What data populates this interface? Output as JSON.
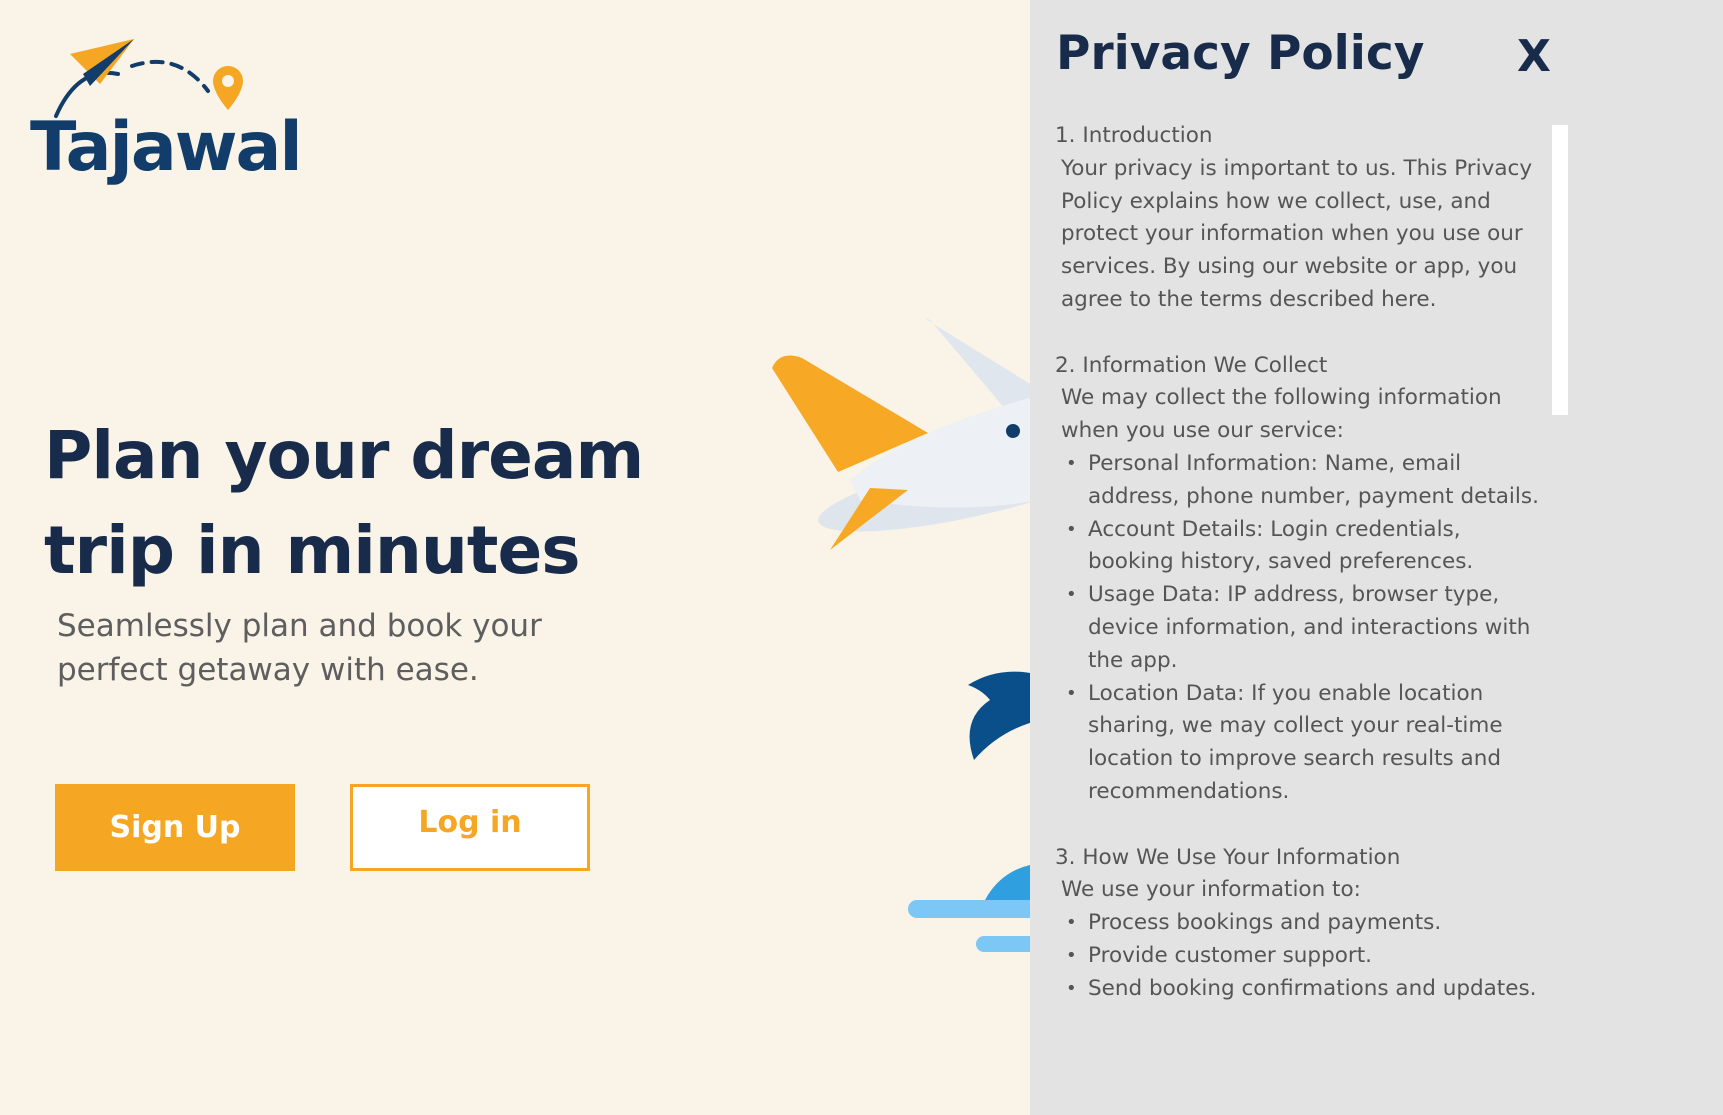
{
  "brand": {
    "name": "Tajawal"
  },
  "hero": {
    "title_line1": "Plan your dream",
    "title_line2": "trip in minutes",
    "subtitle_line1": "Seamlessly plan and book your",
    "subtitle_line2": "perfect getaway with ease."
  },
  "actions": {
    "signup_label": "Sign Up",
    "login_label": "Log in"
  },
  "colors": {
    "accent": "#f5a623",
    "navy": "#182b4a",
    "background": "#f9f3e8",
    "panel": "#e3e3e3"
  },
  "privacy_panel": {
    "title": "Privacy Policy",
    "close_label": "X",
    "sections": [
      {
        "heading": "1. Introduction",
        "body": "Your privacy is important to us. This Privacy Policy explains how we collect, use, and protect your information when you use our services. By using our website or app, you agree to the terms described here.",
        "items": []
      },
      {
        "heading": "2. Information We Collect",
        "body": "We may collect the following information when you use our service:",
        "items": [
          "Personal Information: Name, email address, phone number, payment details.",
          "Account Details: Login credentials, booking history, saved preferences.",
          "Usage Data: IP address, browser type, device information, and interactions with the app.",
          "Location Data: If you enable location sharing, we may collect your real-time location to improve search results and recommendations."
        ]
      },
      {
        "heading": "3. How We Use Your Information",
        "body": "We use your information to:",
        "items": [
          "Process bookings and payments.",
          "Provide customer support.",
          "Send booking confirmations and updates."
        ]
      }
    ]
  }
}
